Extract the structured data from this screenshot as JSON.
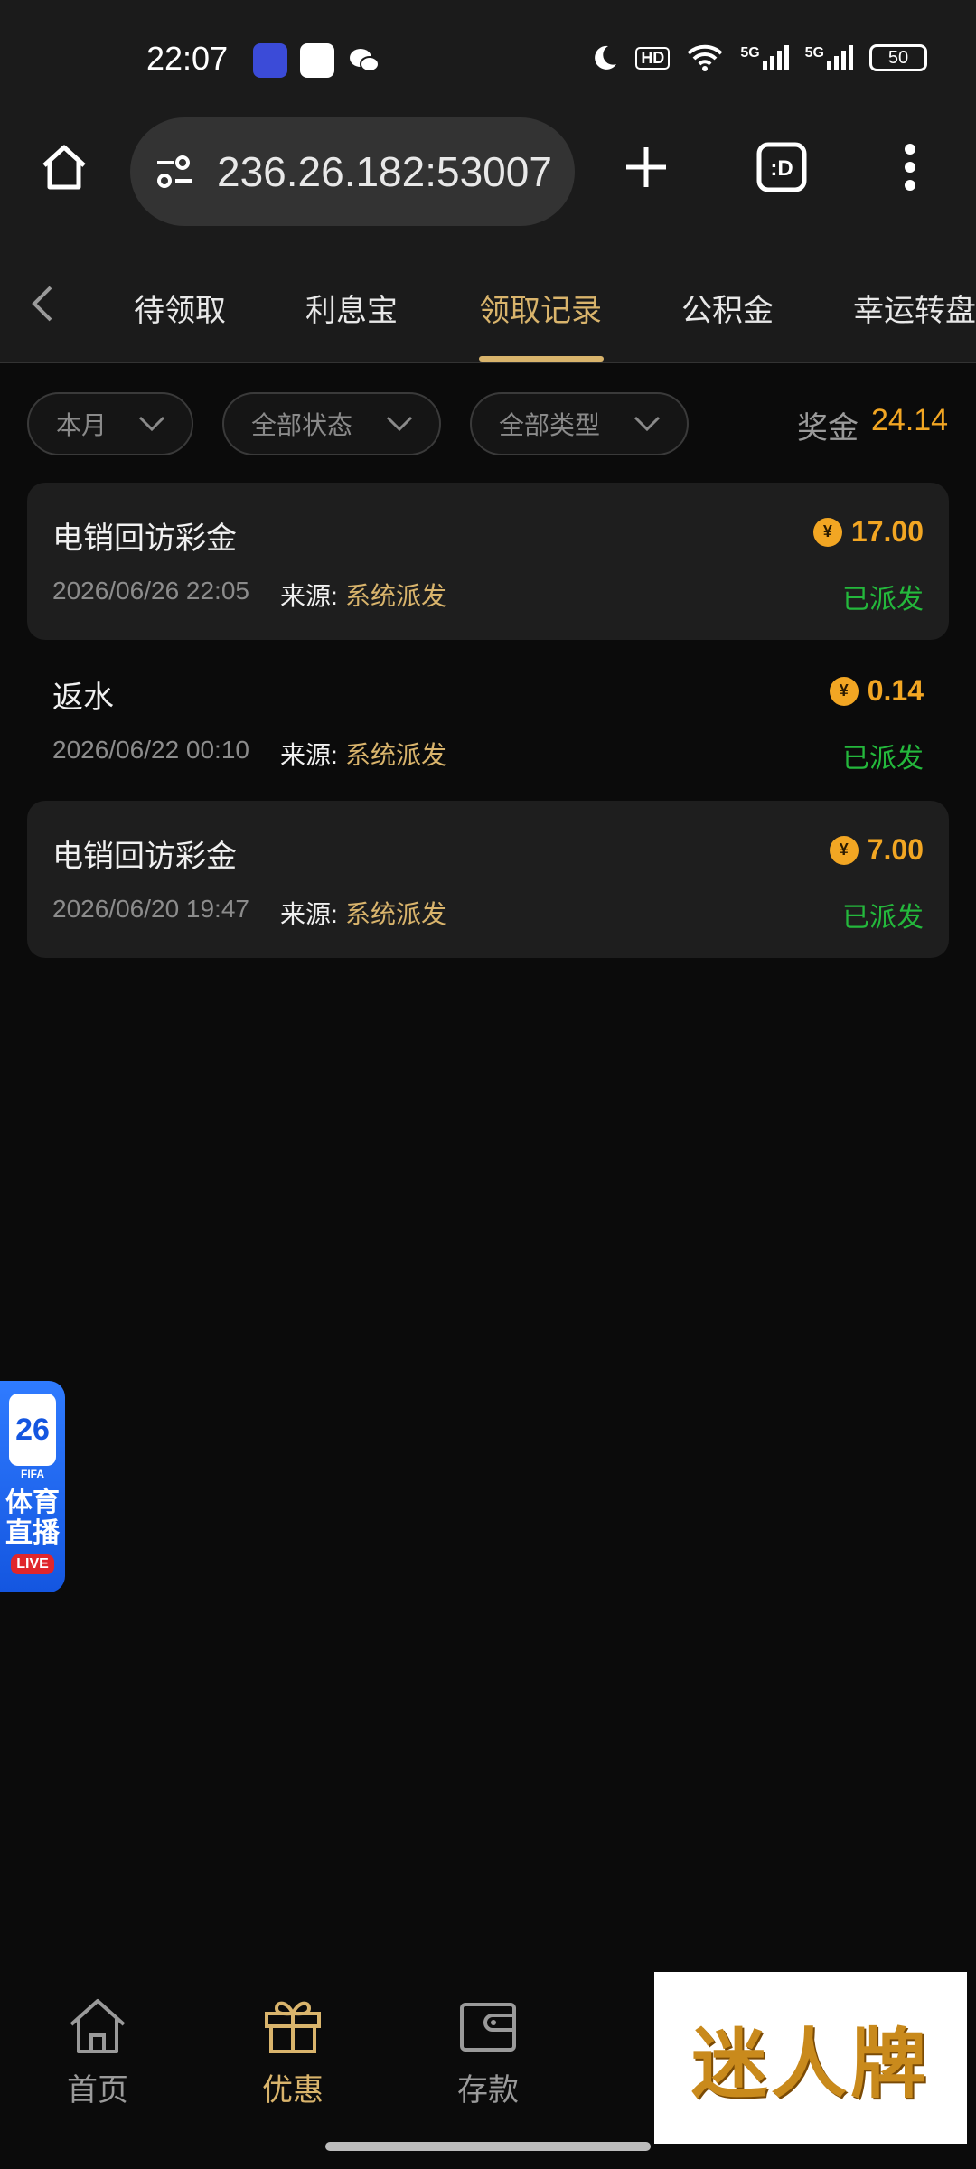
{
  "status_bar": {
    "time": "22:07",
    "battery": "50",
    "network": "5G",
    "hd": "HD"
  },
  "browser": {
    "url": "236.26.182:53007"
  },
  "tabs": [
    {
      "label": "待领取"
    },
    {
      "label": "利息宝"
    },
    {
      "label": "领取记录"
    },
    {
      "label": "公积金"
    },
    {
      "label": "幸运转盘"
    }
  ],
  "filters": {
    "period": "本月",
    "status": "全部状态",
    "type": "全部类型"
  },
  "bonus": {
    "label": "奖金",
    "value": "24.14"
  },
  "records": [
    {
      "title": "电销回访彩金",
      "amount": "17.00",
      "date": "2026/06/26 22:05",
      "source_label": "来源:",
      "source": "系统派发",
      "status": "已派发"
    },
    {
      "title": "返水",
      "amount": "0.14",
      "date": "2026/06/22 00:10",
      "source_label": "来源:",
      "source": "系统派发",
      "status": "已派发"
    },
    {
      "title": "电销回访彩金",
      "amount": "7.00",
      "date": "2026/06/20 19:47",
      "source_label": "来源:",
      "source": "系统派发",
      "status": "已派发"
    }
  ],
  "currency_symbol": "¥",
  "float_badge": {
    "number": "26",
    "line1": "体育",
    "line2": "直播",
    "live": "LIVE",
    "fifa": "FIFA"
  },
  "bottom_nav": [
    {
      "label": "首页",
      "icon": "home-icon"
    },
    {
      "label": "优惠",
      "icon": "gift-icon"
    },
    {
      "label": "存款",
      "icon": "wallet-icon"
    }
  ],
  "watermark": "迷人牌",
  "colors": {
    "accent": "#d9b46c",
    "amount": "#f2a623",
    "success": "#24b83c",
    "background": "#0b0b0b"
  }
}
